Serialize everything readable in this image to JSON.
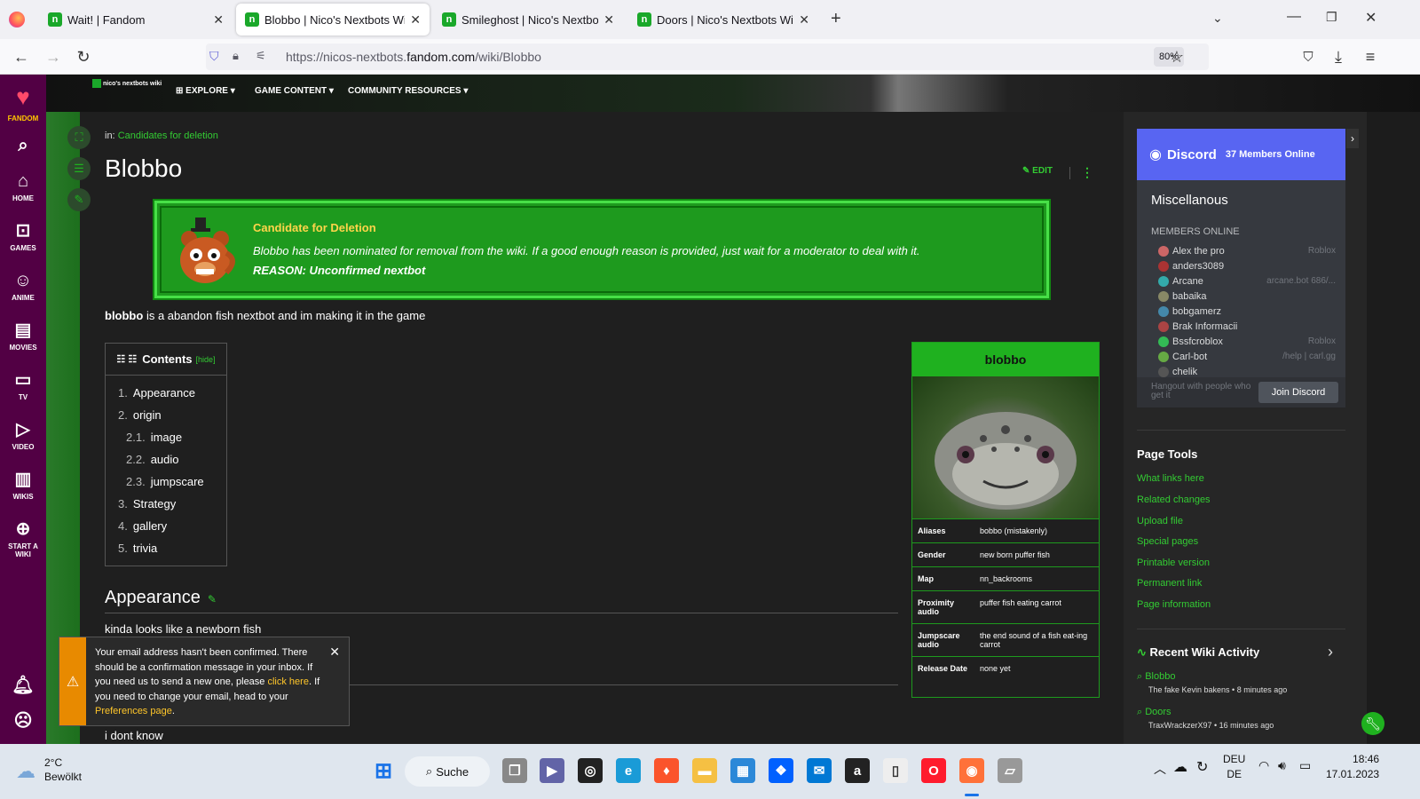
{
  "browser": {
    "tabs": [
      {
        "title": "Wait! | Fandom"
      },
      {
        "title": "Blobbo | Nico's Nextbots Wiki | F"
      },
      {
        "title": "Smileghost | Nico's Nextbots W"
      },
      {
        "title": "Doors | Nico's Nextbots Wiki | F"
      }
    ],
    "url_prefix": "https://nicos-nextbots.",
    "url_domain": "fandom.com",
    "url_suffix": "/wiki/Blobbo",
    "zoom": "80%"
  },
  "rail": {
    "brand": "FANDOM",
    "items": [
      "HOME",
      "GAMES",
      "ANIME",
      "MOVIES",
      "TV",
      "VIDEO",
      "WIKIS",
      "START A WIKI"
    ]
  },
  "topnav": {
    "logo": "nico's nextbots wiki",
    "explore": "EXPLORE",
    "game_content": "GAME CONTENT",
    "community": "COMMUNITY RESOURCES"
  },
  "article": {
    "crumb_prefix": "in:",
    "crumb_link": "Candidates for deletion",
    "title": "Blobbo",
    "edit": "EDIT",
    "deletion": {
      "heading": "Candidate for Deletion",
      "text": "Blobbo has been nominated for removal from the wiki. If a good enough reason is provided, just wait for a moderator to deal with it.",
      "reason": "REASON: Unconfirmed nextbot"
    },
    "intro_bold": "blobbo",
    "intro_rest": " is a abandon fish nextbot and im making it in the game",
    "toc": {
      "title": "Contents",
      "hide": "hide",
      "items": [
        {
          "n": "1.",
          "label": "Appearance"
        },
        {
          "n": "2.",
          "label": "origin"
        },
        {
          "n": "2.1.",
          "label": "image"
        },
        {
          "n": "2.2.",
          "label": "audio"
        },
        {
          "n": "2.3.",
          "label": "jumpscare"
        },
        {
          "n": "3.",
          "label": "Strategy"
        },
        {
          "n": "4.",
          "label": "gallery"
        },
        {
          "n": "5.",
          "label": "trivia"
        }
      ]
    },
    "appearance_heading": "Appearance",
    "appearance_text": "kinda looks like a newborn fish",
    "dont_know": "i dont know"
  },
  "infobox": {
    "title": "blobbo",
    "rows": [
      {
        "k": "Aliases",
        "v": "bobbo (mistakenly)"
      },
      {
        "k": "Gender",
        "v": "new born puffer fish"
      },
      {
        "k": "Map",
        "v": "nn_backrooms"
      },
      {
        "k": "Proximity audio",
        "v": "puffer fish eating carrot"
      },
      {
        "k": "Jumpscare audio",
        "v": "the end sound of a fish eat-ing carrot"
      },
      {
        "k": "Release Date",
        "v": "none yet"
      }
    ]
  },
  "toast": {
    "part1": "Your email address hasn't been confirmed. There should be a confirmation message in your inbox. If you need us to send a new one, please ",
    "link1": "click here",
    "part2": ". If you need to change your email, head to your ",
    "link2": "Preferences page",
    "part3": "."
  },
  "discord": {
    "logo": "Discord",
    "online": "37 Members Online",
    "server": "Miscellanous",
    "members_header": "MEMBERS ONLINE",
    "members": [
      {
        "name": "Alex the pro",
        "game": "Roblox"
      },
      {
        "name": "anders3089",
        "game": ""
      },
      {
        "name": "Arcane",
        "game": "arcane.bot 686/..."
      },
      {
        "name": "babaika",
        "game": ""
      },
      {
        "name": "bobgamerz",
        "game": ""
      },
      {
        "name": "Brak Informacii",
        "game": ""
      },
      {
        "name": "Bssfcroblox",
        "game": "Roblox"
      },
      {
        "name": "Carl-bot",
        "game": "/help | carl.gg"
      },
      {
        "name": "chelik",
        "game": ""
      }
    ],
    "hangout": "Hangout with people who get it",
    "join": "Join Discord"
  },
  "page_tools": {
    "heading": "Page Tools",
    "links": [
      "What links here",
      "Related changes",
      "Upload file",
      "Special pages",
      "Printable version",
      "Permanent link",
      "Page information"
    ]
  },
  "recent": {
    "heading": "Recent Wiki Activity",
    "items": [
      {
        "page": "Blobbo",
        "meta": "The fake Kevin bakens • 8 minutes ago"
      },
      {
        "page": "Doors",
        "meta": "TraxWrackzerX97 • 16 minutes ago"
      }
    ]
  },
  "taskbar": {
    "weather_temp": "2°C",
    "weather_desc": "Bewölkt",
    "search": "Suche",
    "lang1": "DEU",
    "lang2": "DE",
    "time": "18:46",
    "date": "17.01.2023"
  }
}
